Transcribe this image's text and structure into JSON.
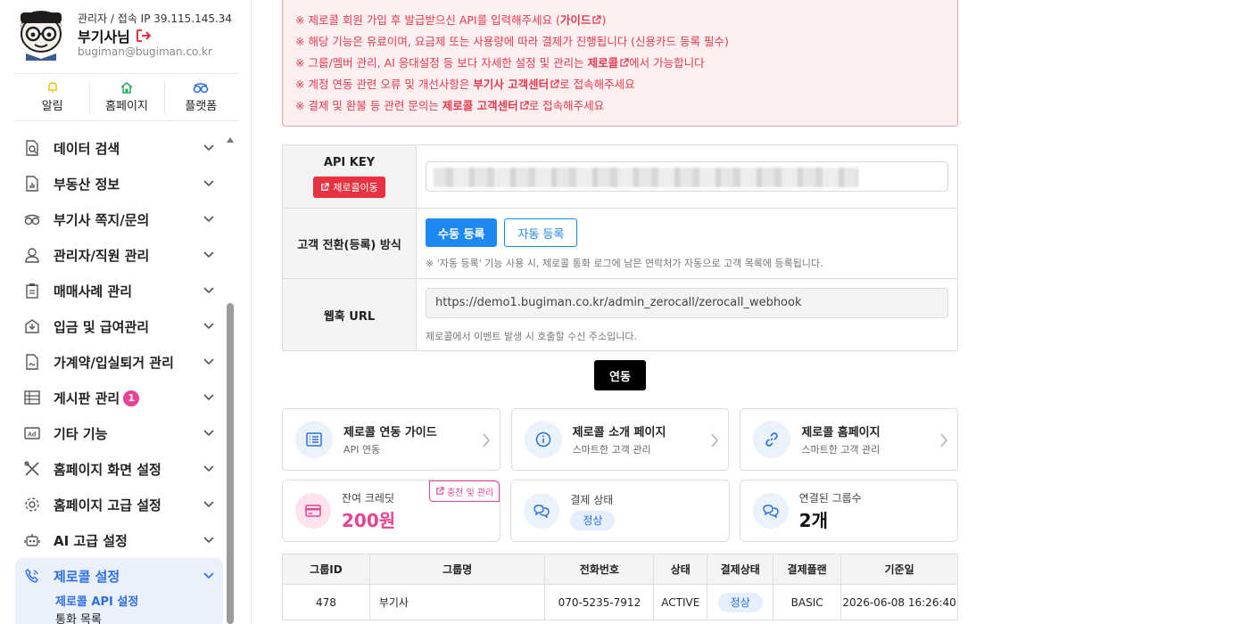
{
  "profile": {
    "role": "관리자 / 접속 IP 39.115.145.34",
    "name": "부기사님",
    "email": "bugiman@bugiman.co.kr"
  },
  "quick_links": [
    {
      "label": "알림",
      "icon": "bell-icon",
      "color": "#f1c40f"
    },
    {
      "label": "홈페이지",
      "icon": "home-icon",
      "color": "#27ae60"
    },
    {
      "label": "플랫폼",
      "icon": "glasses-icon",
      "color": "#2d6ee0"
    }
  ],
  "menu": [
    {
      "label": "데이터 검색",
      "icon": "search-doc-icon"
    },
    {
      "label": "부동산 정보",
      "icon": "chart-doc-icon"
    },
    {
      "label": "부기사 쪽지/문의",
      "icon": "glasses-icon"
    },
    {
      "label": "관리자/직원 관리",
      "icon": "user-icon"
    },
    {
      "label": "매매사례 관리",
      "icon": "clipboard-icon"
    },
    {
      "label": "입금 및 급여관리",
      "icon": "inbox-icon"
    },
    {
      "label": "가계약/입실퇴거 관리",
      "icon": "contract-icon"
    },
    {
      "label": "게시판 관리",
      "icon": "board-icon",
      "badge": "1"
    },
    {
      "label": "기타 기능",
      "icon": "ad-icon"
    },
    {
      "label": "홈페이지 화면 설정",
      "icon": "tools-icon"
    },
    {
      "label": "홈페이지 고급 설정",
      "icon": "gear-icon"
    },
    {
      "label": "AI 고급 설정",
      "icon": "robot-icon"
    }
  ],
  "active_menu": {
    "label": "제로콜 설정",
    "sub": [
      "제로콜 API 설정",
      "통화 목록"
    ]
  },
  "notice": {
    "line1_a": "※ 제로콜 회원 가입 후 발급받으신 API를 입력해주세요 (",
    "line1_b": "가이드",
    "line1_c": ")",
    "line2": "※ 해당 기능은 유료이며, 요금제 또는 사용량에 따라 결제가 진행됩니다 (신용카드 등록 필수)",
    "line3_a": "※ 그룹/멤버 관리, AI 응대설정 등 보다 자세한 설정 및 관리는 ",
    "line3_b": "제로콜",
    "line3_c": "에서 가능합니다",
    "line4_a": "※ 계정 연동 관련 오류 및 개선사항은 ",
    "line4_b": "부기사 고객센터",
    "line4_c": "로 접속해주세요",
    "line5_a": "※ 결제 및 환불 등 관련 문의는 ",
    "line5_b": "제로콜 고객센터",
    "line5_c": "로 접속해주세요"
  },
  "form": {
    "apikey_label": "API KEY",
    "apikey_button": "제로콜이동",
    "mode_label": "고객 전환(등록) 방식",
    "manual_button": "수동 등록",
    "auto_button": "자동 등록",
    "mode_hint": "※ '자동 등록' 기능 사용 시, 제로콜 통화 로그에 남은 연락처가 자동으로 고객 목록에 등록됩니다.",
    "webhook_label": "웹훅 URL",
    "webhook_value": "https://demo1.bugiman.co.kr/admin_zerocall/zerocall_webhook",
    "webhook_hint": "제로콜에서 이벤트 발생 시 호출할 수신 주소입니다."
  },
  "link_button": "연동",
  "cards": [
    {
      "title": "제로콜 연동 가이드",
      "sub": "API 연동",
      "icon": "list-icon"
    },
    {
      "title": "제로콜 소개 페이지",
      "sub": "스마트한 고객 관리",
      "icon": "info-icon"
    },
    {
      "title": "제로콜 홈페이지",
      "sub": "스마트한 고객 관리",
      "icon": "link-icon"
    }
  ],
  "stats": {
    "credit_label": "잔여 크레딧",
    "credit_value": "200원",
    "charge_button": "충전 및 관리",
    "pay_label": "결제 상태",
    "pay_value": "정상",
    "groups_label": "연결된 그룹수",
    "groups_value": "2개"
  },
  "table": {
    "headers": [
      "그룹ID",
      "그룹명",
      "전화번호",
      "상태",
      "결제상태",
      "결제플랜",
      "기준일"
    ],
    "rows": [
      [
        "478",
        "부기사",
        "070-5235-7912",
        "ACTIVE",
        "정상",
        "BASIC",
        "2026-06-08 16:26:40"
      ]
    ]
  },
  "colors": {
    "accent": "#1e88f3",
    "notice_red": "#e03c4f",
    "pink": "#e84393",
    "active_blue": "#2d6ee0"
  }
}
